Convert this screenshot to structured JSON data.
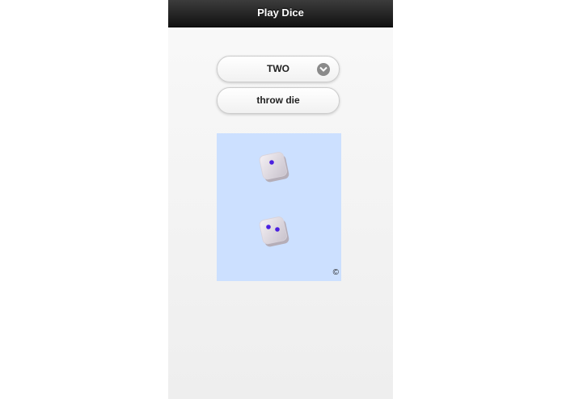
{
  "header": {
    "title": "Play Dice"
  },
  "controls": {
    "select_value": "TWO",
    "throw_label": "throw die"
  },
  "dice": [
    {
      "value": 1
    },
    {
      "value": 2
    }
  ],
  "board": {
    "copyright": "©"
  },
  "colors": {
    "header": "#1a1a1a",
    "board": "#cce0ff",
    "pip": "#4a1fe0"
  }
}
